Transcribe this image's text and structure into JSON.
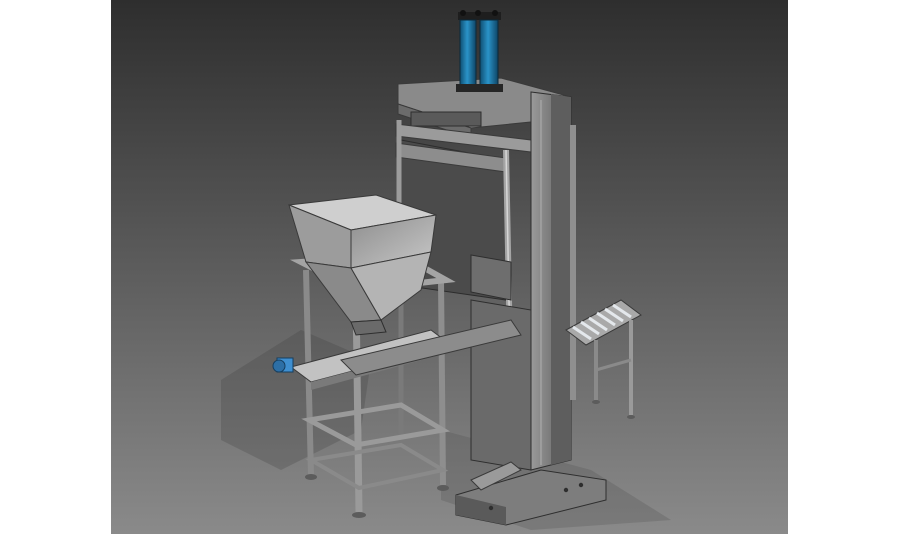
{
  "scene": {
    "subject": "cad-render-vertical-press-with-hopper-frame-and-roller-conveyor",
    "background": {
      "top": "#2e2e2e",
      "bottom": "#8a8a8a"
    },
    "colors": {
      "steel_light": "#b9b9b9",
      "steel_mid": "#8c8c8c",
      "steel_dark": "#5a5a5a",
      "steel_shadow": "#3c3c3c",
      "cylinder_blue": "#1d7fb3",
      "cylinder_cap": "#1e1e1e",
      "roller": "#d8dde3",
      "motor_blue": "#3f8fd0"
    }
  }
}
